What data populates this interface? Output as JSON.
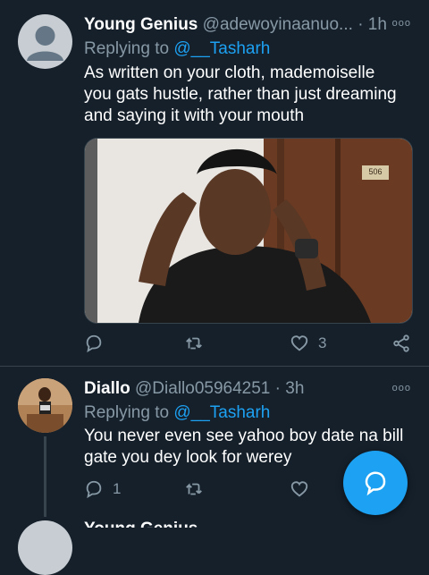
{
  "tweets": [
    {
      "name": "Young Genius",
      "handle": "@adewoyinaanuo...",
      "separator": "·",
      "time": "1h",
      "more": "ooo",
      "replying_prefix": "Replying to",
      "replying_to": "@__Tasharh",
      "text": "As written on your cloth, mademoiselle you gats hustle, rather than just dreaming and saying it with your mouth",
      "media_label": "506",
      "actions": {
        "reply_count": "",
        "retweet_count": "",
        "like_count": "3"
      }
    },
    {
      "name": "Diallo",
      "handle": "@Diallo05964251",
      "separator": "·",
      "time": "3h",
      "more": "ooo",
      "replying_prefix": "Replying to",
      "replying_to": "@__Tasharh",
      "text": "You never even see yahoo boy date na bill gate you dey look for werey",
      "actions": {
        "reply_count": "1",
        "retweet_count": "",
        "like_count": ""
      }
    }
  ],
  "peek_name": "Young Genius",
  "colors": {
    "background": "#15202b",
    "accent": "#1da1f2",
    "muted": "#8899a6",
    "divider": "#38444d"
  },
  "icons": [
    "reply-icon",
    "retweet-icon",
    "like-icon",
    "share-icon",
    "more-icon",
    "compose-icon"
  ]
}
